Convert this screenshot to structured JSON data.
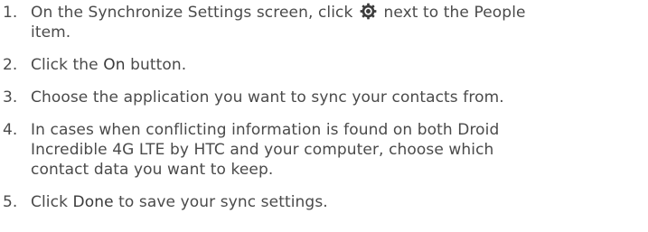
{
  "steps": [
    {
      "number": "1.",
      "line1_before": "On the Synchronize Settings screen, click ",
      "icon": "gear-icon",
      "line1_after": " next to the People",
      "line2": "item."
    },
    {
      "number": "2.",
      "before": "Click the ",
      "emphasis": "On",
      "after": " button."
    },
    {
      "number": "3.",
      "text": "Choose the application you want to sync your contacts from."
    },
    {
      "number": "4.",
      "line1": "In cases when conflicting information is found on both Droid",
      "line2": "Incredible 4G LTE by HTC and your computer, choose which",
      "line3": "contact data you want to keep."
    },
    {
      "number": "5.",
      "before": "Click ",
      "emphasis": "Done",
      "after": " to save your sync settings."
    }
  ]
}
